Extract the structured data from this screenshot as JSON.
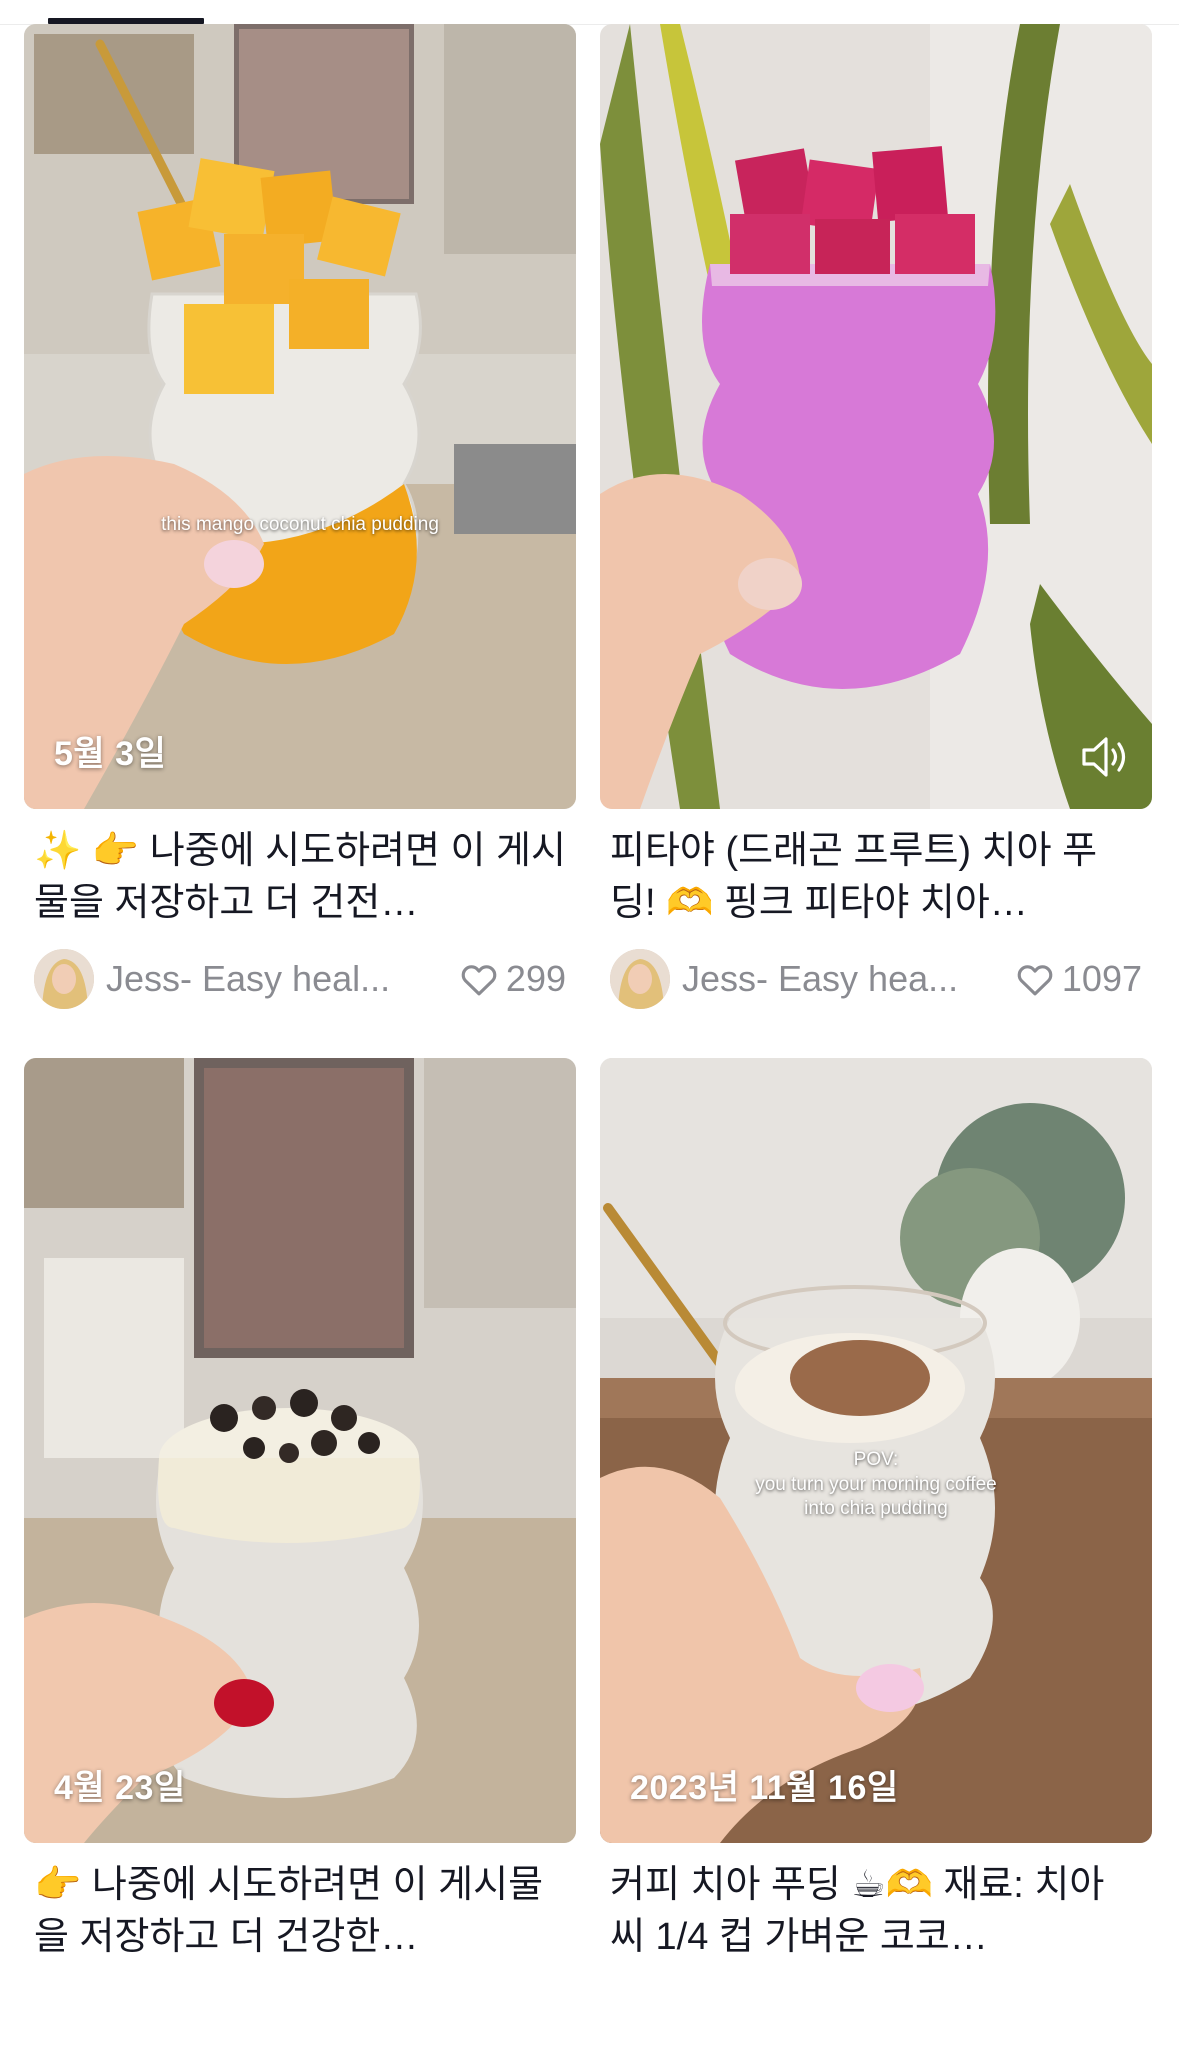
{
  "tabs": {
    "active_index": 0
  },
  "colors": {
    "text": "#161823",
    "secondary": "#8a8b91",
    "overlay_text": "#ffffff"
  },
  "cards": [
    {
      "date": "5월 3일",
      "overlay_text": "this mango coconut chia pudding",
      "title": "✨ 👉 나중에 시도하려면 이 게시물을 저장하고 더 건전…",
      "author": "Jess- Easy heal...",
      "likes": "299",
      "has_sound_icon": false
    },
    {
      "date": "",
      "overlay_text": "",
      "title": "피타야 (드래곤 프루트) 치아 푸딩! 🫶 핑크 피타야 치아…",
      "author": "Jess- Easy hea...",
      "likes": "1097",
      "has_sound_icon": true
    },
    {
      "date": "4월 23일",
      "overlay_text": "",
      "title": "👉 나중에 시도하려면 이 게시물을 저장하고 더 건강한…",
      "author": "",
      "likes": "",
      "has_sound_icon": false
    },
    {
      "date": "2023년 11월 16일",
      "overlay_text": "POV:\nyou turn your morning coffee\ninto chia pudding",
      "title": "커피 치아 푸딩 ☕🫶 재료: 치아 씨 1/4 컵 가벼운 코코…",
      "author": "",
      "likes": "",
      "has_sound_icon": false
    }
  ]
}
